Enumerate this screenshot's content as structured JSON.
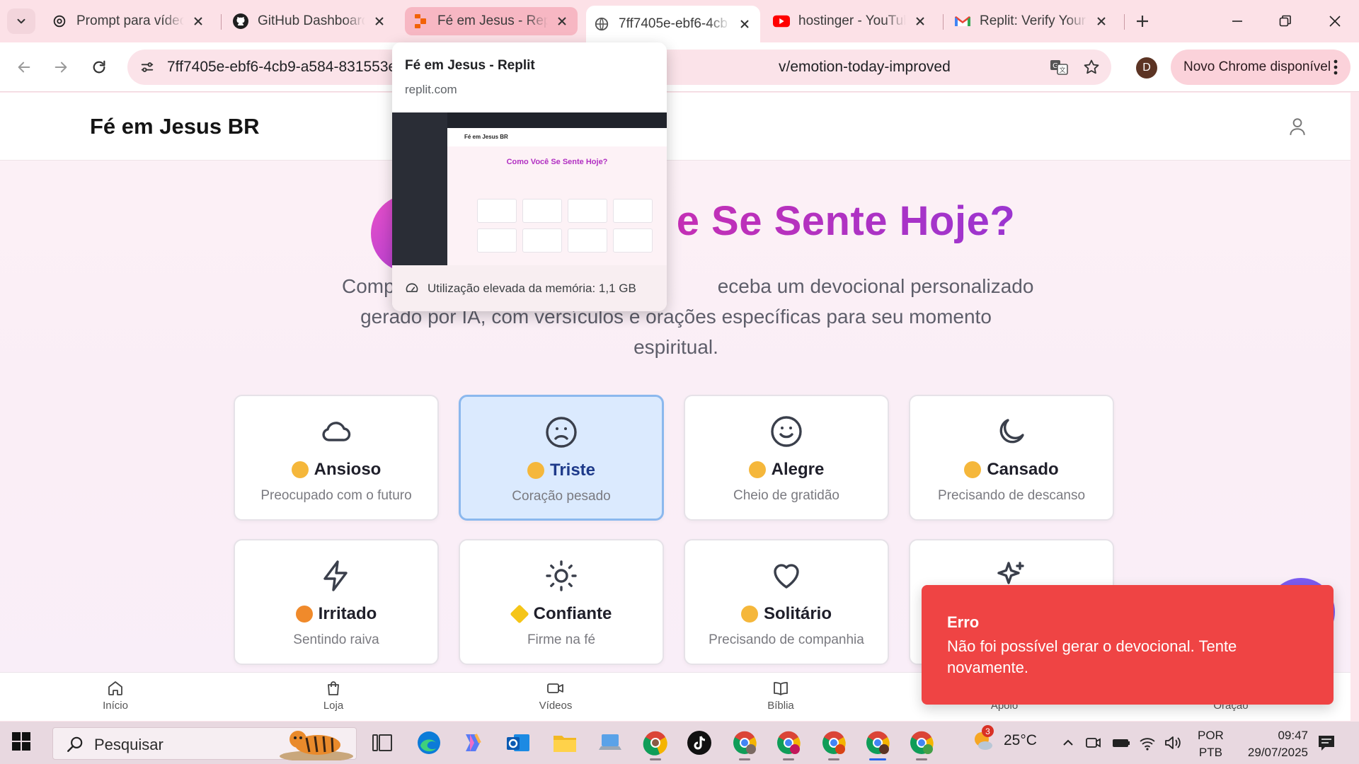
{
  "browser": {
    "tabs": [
      {
        "title": "Prompt para vídeo",
        "favicon": "openai-icon"
      },
      {
        "title": "GitHub Dashboard",
        "favicon": "github-icon"
      },
      {
        "title": "Fé em Jesus - Replit",
        "favicon": "replit-icon"
      },
      {
        "title": "7ff7405e-ebf6-4cb",
        "favicon": "globe-icon"
      },
      {
        "title": "hostinger - YouTube",
        "favicon": "youtube-icon"
      },
      {
        "title": "Replit: Verify Your Email",
        "favicon": "gmail-icon"
      }
    ],
    "url_start": "7ff7405e-ebf6-4cb9-a584-831553e",
    "url_end": "v/emotion-today-improved",
    "profile_initial": "D",
    "update_label": "Novo Chrome disponível"
  },
  "hover_card": {
    "title": "Fé em Jesus - Replit",
    "domain": "replit.com",
    "memory": "Utilização elevada da memória: 1,1 GB",
    "preview_brand": "Fé em Jesus BR",
    "preview_title": "Como Você Se Sente Hoje?"
  },
  "site": {
    "brand": "Fé em Jesus BR",
    "title": "Como Você Se Sente Hoje?",
    "title_visible": "e Se Sente Hoje?",
    "subtitle_left": "Comp",
    "subtitle_line1_right": "eceba um devocional personalizado",
    "subtitle_line2": "gerado por IA, com versículos e orações específicas para seu momento",
    "subtitle_line3": "espiritual."
  },
  "emotions": [
    {
      "name": "Ansioso",
      "desc": "Preocupado com o futuro",
      "icon": "cloud-icon",
      "emoji_color": "#f5b73b",
      "selected": false
    },
    {
      "name": "Triste",
      "desc": "Coração pesado",
      "icon": "sad-face-icon",
      "emoji_color": "#f5b73b",
      "selected": true
    },
    {
      "name": "Alegre",
      "desc": "Cheio de gratidão",
      "icon": "smile-face-icon",
      "emoji_color": "#f5b73b",
      "selected": false
    },
    {
      "name": "Cansado",
      "desc": "Precisando de descanso",
      "icon": "moon-icon",
      "emoji_color": "#f5b73b",
      "selected": false
    },
    {
      "name": "Irritado",
      "desc": "Sentindo raiva",
      "icon": "zap-icon",
      "emoji_color": "#f08a2b",
      "selected": false
    },
    {
      "name": "Confiante",
      "desc": "Firme na fé",
      "icon": "sun-icon",
      "emoji_color": "#f5c518",
      "selected": false
    },
    {
      "name": "Solitário",
      "desc": "Precisando de companhia",
      "icon": "heart-icon",
      "emoji_color": "#f5b73b",
      "selected": false
    },
    {
      "name": "",
      "desc": "",
      "icon": "sparkles-icon",
      "emoji_color": "#f5b73b",
      "selected": false
    }
  ],
  "bottom_nav": [
    {
      "label": "Início",
      "icon": "home-icon"
    },
    {
      "label": "Loja",
      "icon": "shopping-bag-icon"
    },
    {
      "label": "Vídeos",
      "icon": "video-icon"
    },
    {
      "label": "Bíblia",
      "icon": "book-icon"
    },
    {
      "label": "Apoio",
      "icon": "support-icon"
    },
    {
      "label": "Oração",
      "icon": "prayer-icon"
    }
  ],
  "toast": {
    "title": "Erro",
    "message": "Não foi possível gerar o devocional. Tente novamente.",
    "color": "#ef4444"
  },
  "taskbar": {
    "search_placeholder": "Pesquisar",
    "temperature": "25°C",
    "weather_badge": "3",
    "lang_line1": "POR",
    "lang_line2": "PTB",
    "time": "09:47",
    "date": "29/07/2025"
  },
  "colors": {
    "accent": "#b12fc2",
    "selected_card_bg": "#dbeafe",
    "tab_strip": "#fce1e7"
  }
}
